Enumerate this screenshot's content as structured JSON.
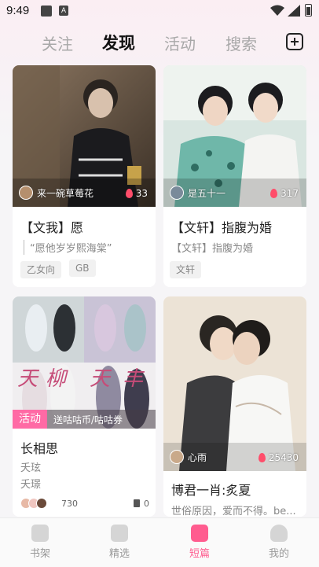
{
  "status_bar": {
    "time": "9:49",
    "notif_label": "A"
  },
  "top_tabs": [
    {
      "label": "关注"
    },
    {
      "label": "发现",
      "active": true
    },
    {
      "label": "活动"
    },
    {
      "label": "搜索"
    }
  ],
  "cards": [
    {
      "author": "来一碗草莓花",
      "heat": "33",
      "title": "【文我】愿",
      "subtitle": "“愿他岁岁熙海棠”",
      "tags": [
        "乙女向",
        "GB"
      ]
    },
    {
      "author": "是五十一",
      "heat": "317",
      "title": "【文轩】指腹为婚",
      "subtitle": "【文轩】指腹为婚",
      "tags": [
        "文轩"
      ]
    },
    {
      "activity_badge": "活动",
      "activity_text": "送咕咕币/咕咕券",
      "cover_text": [
        "天",
        "柳",
        "天",
        "丰"
      ],
      "title": "长相思",
      "lines": [
        "夭玹",
        "夭璟"
      ],
      "participants": "730",
      "books": "0"
    },
    {
      "author": "心雨",
      "heat": "25430",
      "title": "博君一肖:炙夏",
      "subtitle": "世俗原因，爱而不得。be..."
    }
  ],
  "bottom_nav": [
    {
      "label": "书架",
      "icon": "bookshelf-icon"
    },
    {
      "label": "精选",
      "icon": "featured-icon"
    },
    {
      "label": "短篇",
      "icon": "short-story-icon",
      "active": true
    },
    {
      "label": "我的",
      "icon": "profile-icon"
    }
  ],
  "colors": {
    "accent": "#ff5c8f",
    "activity": "#ff6aa5",
    "heat": "#ff4d6a"
  }
}
